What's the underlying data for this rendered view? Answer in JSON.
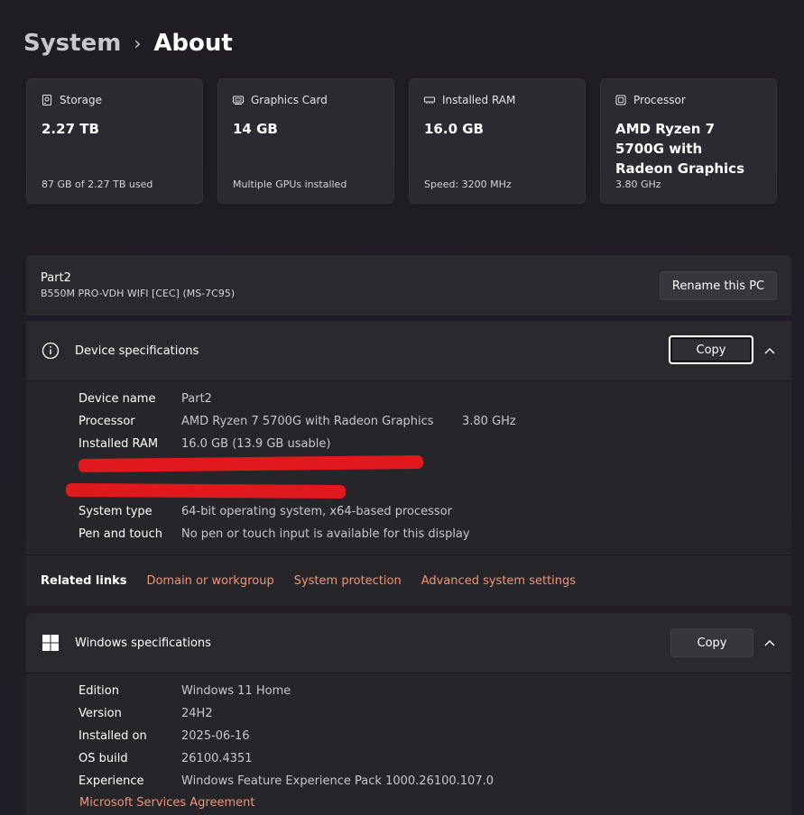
{
  "breadcrumb": {
    "parent": "System",
    "separator": "›",
    "current": "About"
  },
  "cards": [
    {
      "icon": "storage-icon",
      "title": "Storage",
      "value": "2.27 TB",
      "sub": "87 GB of 2.27 TB used"
    },
    {
      "icon": "graphics-card-icon",
      "title": "Graphics Card",
      "value": "14 GB",
      "sub": "Multiple GPUs installed"
    },
    {
      "icon": "ram-icon",
      "title": "Installed RAM",
      "value": "16.0 GB",
      "sub": "Speed: 3200 MHz"
    },
    {
      "icon": "processor-icon",
      "title": "Processor",
      "value": "AMD Ryzen 7 5700G with Radeon Graphics",
      "sub": "3.80 GHz"
    }
  ],
  "pc": {
    "name": "Part2",
    "model": "B550M PRO-VDH WIFI [CEC] (MS-7C95)",
    "rename_label": "Rename this PC"
  },
  "device_specs": {
    "title": "Device specifications",
    "copy_label": "Copy",
    "rows": [
      {
        "label": "Device name",
        "value": "Part2"
      },
      {
        "label": "Processor",
        "value": "AMD Ryzen 7 5700G with Radeon Graphics",
        "extra": "3.80 GHz"
      },
      {
        "label": "Installed RAM",
        "value": "16.0 GB (13.9 GB usable)"
      },
      {
        "label": "System type",
        "value": "64-bit operating system, x64-based processor"
      },
      {
        "label": "Pen and touch",
        "value": "No pen or touch input is available for this display"
      }
    ]
  },
  "related": {
    "label": "Related links",
    "links": [
      "Domain or workgroup",
      "System protection",
      "Advanced system settings"
    ]
  },
  "windows_specs": {
    "title": "Windows specifications",
    "copy_label": "Copy",
    "rows": [
      {
        "label": "Edition",
        "value": "Windows 11 Home"
      },
      {
        "label": "Version",
        "value": "24H2"
      },
      {
        "label": "Installed on",
        "value": "2025-06-16"
      },
      {
        "label": "OS build",
        "value": "26100.4351"
      },
      {
        "label": "Experience",
        "value": "Windows Feature Experience Pack 1000.26100.107.0"
      }
    ],
    "agreement_link": "Microsoft Services Agreement"
  },
  "colors": {
    "link": "#f19577",
    "redaction": "#e2191c",
    "card_bg": "#2b2a30"
  }
}
